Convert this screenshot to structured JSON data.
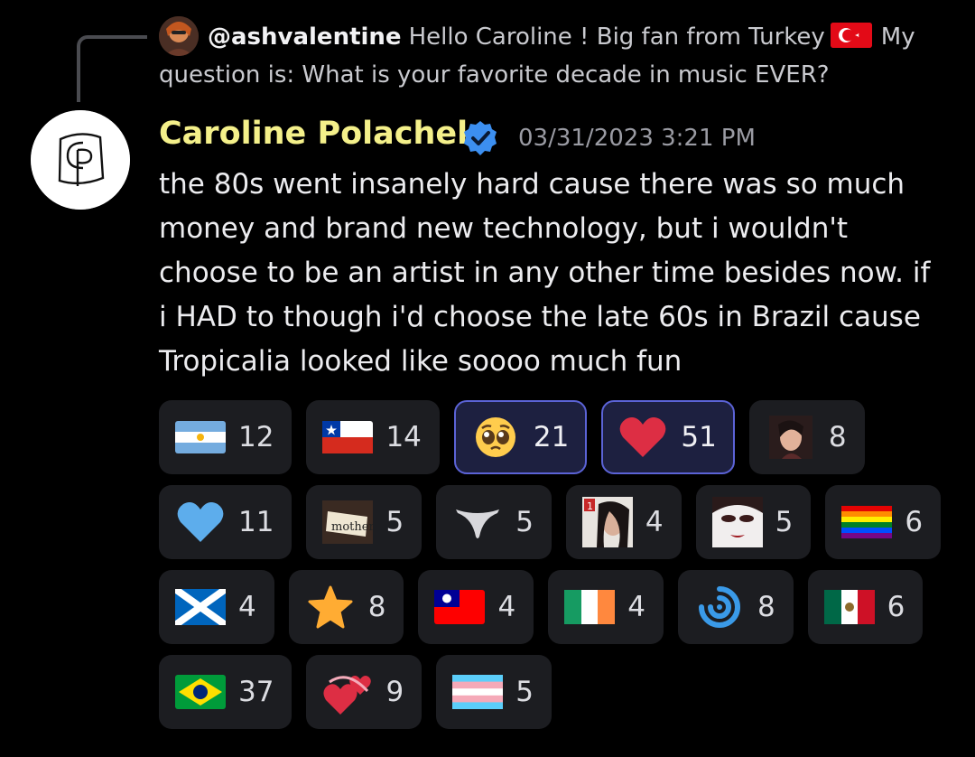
{
  "reply": {
    "handle": "@ashvalentine",
    "text_before_flag": "Hello Caroline ! Big fan from Turkey",
    "text_after_flag": "My question is: What is your favorite decade in music EVER?"
  },
  "message": {
    "author": "Caroline Polachek",
    "timestamp": "03/31/2023 3:21 PM",
    "body": "the 80s went insanely hard cause there was so much money and brand new technology, but i wouldn't choose to be an artist in any other time besides now. if i HAD to though i'd choose the late 60s in Brazil cause Tropicalia looked like soooo much fun"
  },
  "colors": {
    "author_name": "#f4f08a",
    "verified_badge": "#3c8ff0",
    "active_reaction_border": "#5b63d6"
  },
  "reactions": [
    [
      {
        "emoji": "flag-argentina",
        "count": "12",
        "active": false
      },
      {
        "emoji": "flag-chile",
        "count": "14",
        "active": false
      },
      {
        "emoji": "pleading-face",
        "count": "21",
        "active": true
      },
      {
        "emoji": "red-heart",
        "count": "51",
        "active": true
      },
      {
        "emoji": "custom-photo-woman",
        "count": "8",
        "active": false
      }
    ],
    [
      {
        "emoji": "blue-heart",
        "count": "11",
        "active": false
      },
      {
        "emoji": "custom-mother-sign",
        "count": "5",
        "active": false
      },
      {
        "emoji": "custom-thong",
        "count": "5",
        "active": false
      },
      {
        "emoji": "custom-calendar-photo",
        "count": "4",
        "active": false
      },
      {
        "emoji": "custom-vampire-face",
        "count": "5",
        "active": false
      },
      {
        "emoji": "rainbow-flag",
        "count": "6",
        "active": false
      }
    ],
    [
      {
        "emoji": "flag-scotland",
        "count": "4",
        "active": false
      },
      {
        "emoji": "star",
        "count": "8",
        "active": false
      },
      {
        "emoji": "flag-taiwan",
        "count": "4",
        "active": false
      },
      {
        "emoji": "flag-ireland",
        "count": "4",
        "active": false
      },
      {
        "emoji": "custom-blue-swirl",
        "count": "8",
        "active": false
      },
      {
        "emoji": "flag-mexico",
        "count": "6",
        "active": false
      }
    ],
    [
      {
        "emoji": "flag-brazil",
        "count": "37",
        "active": false
      },
      {
        "emoji": "revolving-hearts",
        "count": "9",
        "active": false
      },
      {
        "emoji": "transgender-flag",
        "count": "5",
        "active": false
      }
    ]
  ]
}
